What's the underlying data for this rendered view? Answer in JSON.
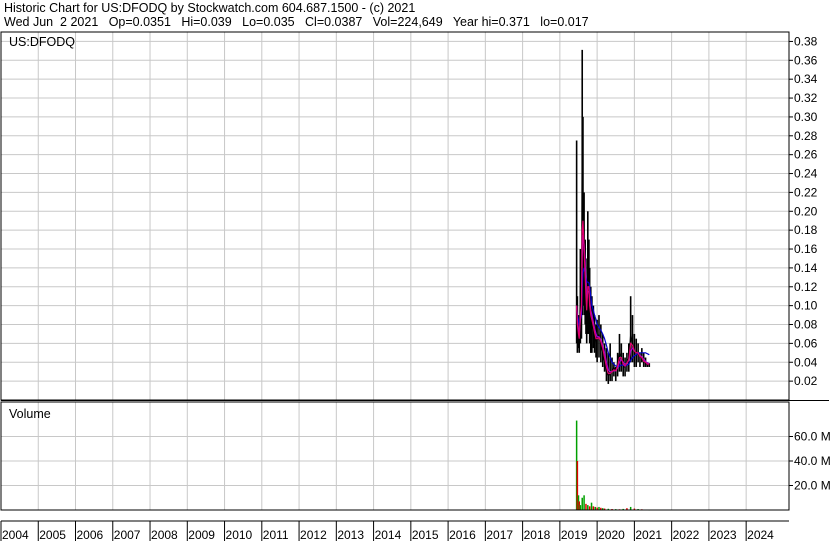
{
  "header": {
    "line1": "Historic Chart for US:DFODQ by Stockwatch.com 604.687.1500 - (c) 2021",
    "line2": "Wed Jun  2 2021   Op=0.0351   Hi=0.039   Lo=0.035   Cl=0.0387   Vol=224,649   Year hi=0.371   lo=0.017"
  },
  "colors": {
    "price": "#000000",
    "ma_short": "#e0006c",
    "ma_mid": "#a000e0",
    "ma_long": "#0000cc",
    "vol_up": "#00a000",
    "vol_down": "#e00000",
    "grid": "#c8c8c8",
    "border": "#000000"
  },
  "chart_data": [
    {
      "type": "line",
      "panel": "price",
      "label": "US:DFODQ",
      "ylim": [
        0,
        0.39
      ],
      "yticks": [
        "0.38",
        "0.36",
        "0.34",
        "0.32",
        "0.30",
        "0.28",
        "0.26",
        "0.24",
        "0.22",
        "0.20",
        "0.18",
        "0.16",
        "0.14",
        "0.12",
        "0.10",
        "0.08",
        "0.06",
        "0.04",
        "0.02"
      ],
      "ytick_values": [
        0.38,
        0.36,
        0.34,
        0.32,
        0.3,
        0.28,
        0.26,
        0.24,
        0.22,
        0.2,
        0.18,
        0.16,
        0.14,
        0.12,
        0.1,
        0.08,
        0.06,
        0.04,
        0.02
      ],
      "x": [
        2019.45,
        2019.47,
        2019.5,
        2019.52,
        2019.55,
        2019.58,
        2019.6,
        2019.62,
        2019.65,
        2019.68,
        2019.7,
        2019.72,
        2019.75,
        2019.78,
        2019.8,
        2019.83,
        2019.86,
        2019.9,
        2019.93,
        2019.97,
        2020.0,
        2020.05,
        2020.1,
        2020.15,
        2020.2,
        2020.25,
        2020.3,
        2020.35,
        2020.4,
        2020.45,
        2020.5,
        2020.55,
        2020.6,
        2020.65,
        2020.7,
        2020.75,
        2020.8,
        2020.85,
        2020.9,
        2020.95,
        2021.0,
        2021.05,
        2021.1,
        2021.15,
        2021.2,
        2021.25,
        2021.3,
        2021.35,
        2021.4
      ],
      "high": [
        0.275,
        0.11,
        0.09,
        0.08,
        0.16,
        0.14,
        0.371,
        0.3,
        0.22,
        0.17,
        0.15,
        0.11,
        0.2,
        0.17,
        0.14,
        0.12,
        0.11,
        0.1,
        0.09,
        0.08,
        0.085,
        0.09,
        0.08,
        0.07,
        0.06,
        0.055,
        0.05,
        0.06,
        0.045,
        0.04,
        0.035,
        0.05,
        0.07,
        0.06,
        0.05,
        0.045,
        0.05,
        0.06,
        0.11,
        0.09,
        0.07,
        0.065,
        0.06,
        0.05,
        0.055,
        0.05,
        0.045,
        0.04,
        0.039
      ],
      "low": [
        0.06,
        0.05,
        0.055,
        0.05,
        0.06,
        0.065,
        0.09,
        0.1,
        0.09,
        0.08,
        0.07,
        0.06,
        0.07,
        0.07,
        0.06,
        0.05,
        0.05,
        0.055,
        0.05,
        0.045,
        0.04,
        0.045,
        0.04,
        0.035,
        0.03,
        0.02,
        0.017,
        0.02,
        0.02,
        0.025,
        0.02,
        0.025,
        0.03,
        0.03,
        0.025,
        0.025,
        0.03,
        0.03,
        0.04,
        0.04,
        0.035,
        0.035,
        0.04,
        0.035,
        0.04,
        0.035,
        0.035,
        0.035,
        0.035
      ],
      "close": [
        0.1,
        0.07,
        0.065,
        0.06,
        0.12,
        0.1,
        0.3,
        0.2,
        0.15,
        0.12,
        0.1,
        0.08,
        0.16,
        0.12,
        0.1,
        0.085,
        0.08,
        0.075,
        0.07,
        0.06,
        0.065,
        0.07,
        0.06,
        0.05,
        0.04,
        0.03,
        0.025,
        0.03,
        0.03,
        0.035,
        0.03,
        0.04,
        0.05,
        0.045,
        0.035,
        0.035,
        0.04,
        0.045,
        0.07,
        0.06,
        0.05,
        0.05,
        0.05,
        0.045,
        0.045,
        0.04,
        0.04,
        0.037,
        0.0387
      ],
      "ma_short": [
        0.1,
        0.08,
        0.07,
        0.065,
        0.09,
        0.1,
        0.18,
        0.19,
        0.16,
        0.13,
        0.11,
        0.095,
        0.12,
        0.12,
        0.1,
        0.09,
        0.085,
        0.078,
        0.072,
        0.065,
        0.065,
        0.066,
        0.062,
        0.055,
        0.045,
        0.035,
        0.028,
        0.028,
        0.03,
        0.032,
        0.031,
        0.036,
        0.045,
        0.045,
        0.038,
        0.036,
        0.039,
        0.043,
        0.06,
        0.058,
        0.052,
        0.05,
        0.05,
        0.046,
        0.045,
        0.041,
        0.04,
        0.038,
        0.038
      ],
      "ma_mid": [
        0.1,
        0.085,
        0.075,
        0.07,
        0.085,
        0.095,
        0.15,
        0.175,
        0.165,
        0.145,
        0.125,
        0.105,
        0.115,
        0.115,
        0.105,
        0.095,
        0.09,
        0.082,
        0.076,
        0.07,
        0.067,
        0.067,
        0.064,
        0.058,
        0.05,
        0.04,
        0.032,
        0.03,
        0.03,
        0.031,
        0.031,
        0.034,
        0.04,
        0.043,
        0.04,
        0.038,
        0.039,
        0.042,
        0.052,
        0.055,
        0.052,
        0.05,
        0.05,
        0.047,
        0.046,
        0.043,
        0.041,
        0.039,
        0.039
      ],
      "ma_long": [
        0.1,
        0.09,
        0.085,
        0.08,
        0.085,
        0.09,
        0.12,
        0.135,
        0.14,
        0.135,
        0.13,
        0.125,
        0.125,
        0.124,
        0.12,
        0.11,
        0.1,
        0.095,
        0.09,
        0.085,
        0.08,
        0.077,
        0.074,
        0.07,
        0.065,
        0.058,
        0.05,
        0.045,
        0.04,
        0.038,
        0.036,
        0.035,
        0.036,
        0.037,
        0.037,
        0.036,
        0.037,
        0.038,
        0.042,
        0.045,
        0.047,
        0.048,
        0.05,
        0.05,
        0.05,
        0.05,
        0.05,
        0.049,
        0.048
      ]
    },
    {
      "type": "bar",
      "panel": "volume",
      "label": "Volume",
      "ylim": [
        0,
        80000000
      ],
      "yticks": [
        "60.0 M",
        "40.0 M",
        "20.0 M"
      ],
      "ytick_values": [
        60000000,
        40000000,
        20000000
      ],
      "x": [
        2019.45,
        2019.47,
        2019.5,
        2019.52,
        2019.55,
        2019.6,
        2019.65,
        2019.7,
        2019.75,
        2019.8,
        2019.85,
        2019.9,
        2019.95,
        2020.0,
        2020.05,
        2020.1,
        2020.15,
        2020.2,
        2020.3,
        2020.4,
        2020.5,
        2020.6,
        2020.7,
        2020.8,
        2020.9,
        2021.0,
        2021.1,
        2021.2,
        2021.3,
        2021.4
      ],
      "values": [
        73000000,
        40000000,
        12000000,
        7000000,
        4000000,
        10000000,
        12000000,
        5000000,
        4000000,
        3000000,
        6000000,
        3000000,
        2500000,
        2000000,
        2500000,
        1800000,
        1500000,
        1200000,
        1000000,
        800000,
        700000,
        600000,
        900000,
        1500000,
        2500000,
        1200000,
        800000,
        600000,
        400000,
        224649
      ],
      "up": [
        true,
        false,
        true,
        false,
        true,
        true,
        true,
        false,
        true,
        false,
        true,
        false,
        true,
        false,
        true,
        false,
        true,
        false,
        true,
        false,
        true,
        false,
        true,
        false,
        true,
        false,
        true,
        false,
        true,
        true
      ]
    },
    {
      "type": "axis",
      "panel": "time",
      "xlim": [
        2004.0,
        2025.15
      ],
      "categories": [
        "2004",
        "2005",
        "2006",
        "2007",
        "2008",
        "2009",
        "2010",
        "2011",
        "2012",
        "2013",
        "2014",
        "2015",
        "2016",
        "2017",
        "2018",
        "2019",
        "2020",
        "2021",
        "2022",
        "2023",
        "2024"
      ]
    }
  ]
}
